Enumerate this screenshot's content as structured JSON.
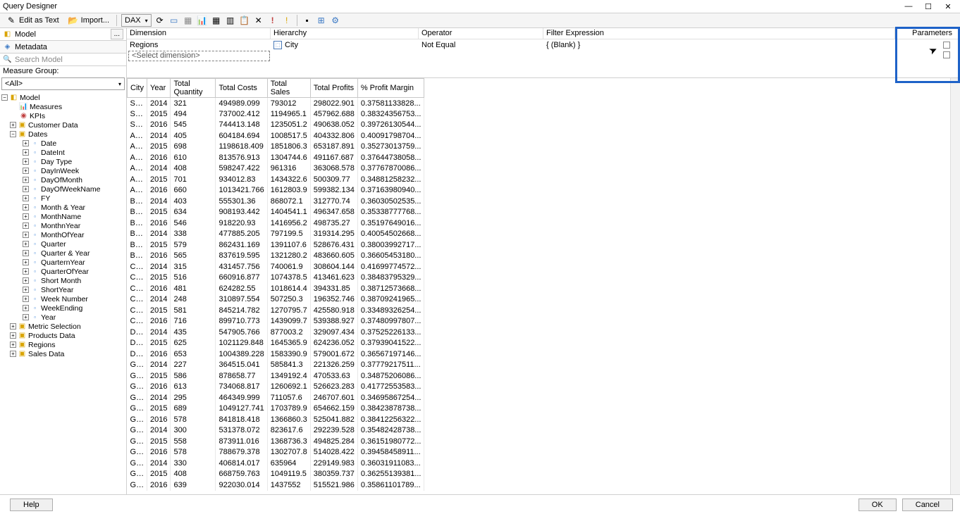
{
  "window": {
    "title": "Query Designer"
  },
  "toolbar": {
    "edit_as_text": "Edit as Text",
    "import": "Import...",
    "dax_label": "DAX"
  },
  "left": {
    "model_label": "Model",
    "metadata_label": "Metadata",
    "search_placeholder": "Search Model",
    "measure_group_label": "Measure Group:",
    "measure_group_value": "<All>",
    "tree": {
      "root": "Model",
      "measures": "Measures",
      "kpis": "KPIs",
      "customer_data": "Customer Data",
      "dates": "Dates",
      "date_children": [
        "Date",
        "DateInt",
        "Day Type",
        "DayInWeek",
        "DayOfMonth",
        "DayOfWeekName",
        "FY",
        "Month & Year",
        "MonthName",
        "MonthnYear",
        "MonthOfYear",
        "Quarter",
        "Quarter & Year",
        "QuarternYear",
        "QuarterOfYear",
        "Short Month",
        "ShortYear",
        "Week Number",
        "WeekEnding",
        "Year"
      ],
      "metric_selection": "Metric Selection",
      "products_data": "Products Data",
      "regions": "Regions",
      "sales_data": "Sales Data"
    }
  },
  "filter": {
    "h_dimension": "Dimension",
    "h_hierarchy": "Hierarchy",
    "h_operator": "Operator",
    "h_filter_expr": "Filter Expression",
    "h_parameters": "Parameters",
    "r1_dimension": "Regions",
    "r1_hierarchy": "City",
    "r1_operator": "Not Equal",
    "r1_expr": "{ (Blank) }",
    "select_dim": "<Select dimension>"
  },
  "grid": {
    "headers": [
      "City",
      "Year",
      "Total Quantity",
      "Total Costs",
      "Total Sales",
      "Total Profits",
      "% Profit Margin"
    ],
    "rows": [
      [
        "Syd...",
        "2014",
        "321",
        "494989.099",
        "793012",
        "298022.901",
        "0.37581133828..."
      ],
      [
        "Syd...",
        "2015",
        "494",
        "737002.412",
        "1194965.1",
        "457962.688",
        "0.38324356753..."
      ],
      [
        "Syd...",
        "2016",
        "545",
        "744413.148",
        "1235051.2",
        "490638.052",
        "0.39726130544..."
      ],
      [
        "Alb...",
        "2014",
        "405",
        "604184.694",
        "1008517.5",
        "404332.806",
        "0.40091798704..."
      ],
      [
        "Alb...",
        "2015",
        "698",
        "1198618.409",
        "1851806.3",
        "653187.891",
        "0.35273013759..."
      ],
      [
        "Alb...",
        "2016",
        "610",
        "813576.913",
        "1304744.6",
        "491167.687",
        "0.37644738058..."
      ],
      [
        "Ar...",
        "2014",
        "408",
        "598247.422",
        "961316",
        "363068.578",
        "0.37767870086..."
      ],
      [
        "Ar...",
        "2015",
        "701",
        "934012.83",
        "1434322.6",
        "500309.77",
        "0.34881258232..."
      ],
      [
        "Ar...",
        "2016",
        "660",
        "1013421.766",
        "1612803.9",
        "599382.134",
        "0.37163980940..."
      ],
      [
        "Bat...",
        "2014",
        "403",
        "555301.36",
        "868072.1",
        "312770.74",
        "0.36030502535..."
      ],
      [
        "Bat...",
        "2015",
        "634",
        "908193.442",
        "1404541.1",
        "496347.658",
        "0.35338777768..."
      ],
      [
        "Bat...",
        "2016",
        "546",
        "918220.93",
        "1416956.2",
        "498735.27",
        "0.35197649016..."
      ],
      [
        "Bro...",
        "2014",
        "338",
        "477885.205",
        "797199.5",
        "319314.295",
        "0.40054502668..."
      ],
      [
        "Bro...",
        "2015",
        "579",
        "862431.169",
        "1391107.6",
        "528676.431",
        "0.38003992717..."
      ],
      [
        "Bro...",
        "2016",
        "565",
        "837619.595",
        "1321280.2",
        "483660.605",
        "0.36605453180..."
      ],
      [
        "Ces...",
        "2014",
        "315",
        "431457.756",
        "740061.9",
        "308604.144",
        "0.41699774572..."
      ],
      [
        "Ces...",
        "2015",
        "516",
        "660916.877",
        "1074378.5",
        "413461.623",
        "0.38483795329..."
      ],
      [
        "Ces...",
        "2016",
        "481",
        "624282.55",
        "1018614.4",
        "394331.85",
        "0.38712573668..."
      ],
      [
        "Cof...",
        "2014",
        "248",
        "310897.554",
        "507250.3",
        "196352.746",
        "0.38709241965..."
      ],
      [
        "Cof...",
        "2015",
        "581",
        "845214.782",
        "1270795.7",
        "425580.918",
        "0.33489326254..."
      ],
      [
        "Cof...",
        "2016",
        "716",
        "899710.773",
        "1439099.7",
        "539388.927",
        "0.37480997807..."
      ],
      [
        "Du...",
        "2014",
        "435",
        "547905.766",
        "877003.2",
        "329097.434",
        "0.37525226133..."
      ],
      [
        "Du...",
        "2015",
        "625",
        "1021129.848",
        "1645365.9",
        "624236.052",
        "0.37939041522..."
      ],
      [
        "Du...",
        "2016",
        "653",
        "1004389.228",
        "1583390.9",
        "579001.672",
        "0.36567197146..."
      ],
      [
        "Go...",
        "2014",
        "227",
        "364515.041",
        "585841.3",
        "221326.259",
        "0.37779217511..."
      ],
      [
        "Go...",
        "2015",
        "586",
        "878658.77",
        "1349192.4",
        "470533.63",
        "0.34875206086..."
      ],
      [
        "Go...",
        "2016",
        "613",
        "734068.817",
        "1260692.1",
        "526623.283",
        "0.41772553583..."
      ],
      [
        "Go...",
        "2014",
        "295",
        "464349.999",
        "711057.6",
        "246707.601",
        "0.34695867254..."
      ],
      [
        "Go...",
        "2015",
        "689",
        "1049127.741",
        "1703789.9",
        "654662.159",
        "0.38423878738..."
      ],
      [
        "Go...",
        "2016",
        "578",
        "841818.418",
        "1366860.3",
        "525041.882",
        "0.38412256322..."
      ],
      [
        "Gra...",
        "2014",
        "300",
        "531378.072",
        "823617.6",
        "292239.528",
        "0.35482428738..."
      ],
      [
        "Gra...",
        "2015",
        "558",
        "873911.016",
        "1368736.3",
        "494825.284",
        "0.36151980772..."
      ],
      [
        "Gra...",
        "2016",
        "578",
        "788679.378",
        "1302707.8",
        "514028.422",
        "0.39458458911..."
      ],
      [
        "Grif...",
        "2014",
        "330",
        "406814.017",
        "635964",
        "229149.983",
        "0.36031911083..."
      ],
      [
        "Grif...",
        "2015",
        "408",
        "668759.763",
        "1049119.5",
        "380359.737",
        "0.36255139381..."
      ],
      [
        "Grif...",
        "2016",
        "639",
        "922030.014",
        "1437552",
        "515521.986",
        "0.35861101789..."
      ]
    ]
  },
  "footer": {
    "help": "Help",
    "ok": "OK",
    "cancel": "Cancel"
  }
}
